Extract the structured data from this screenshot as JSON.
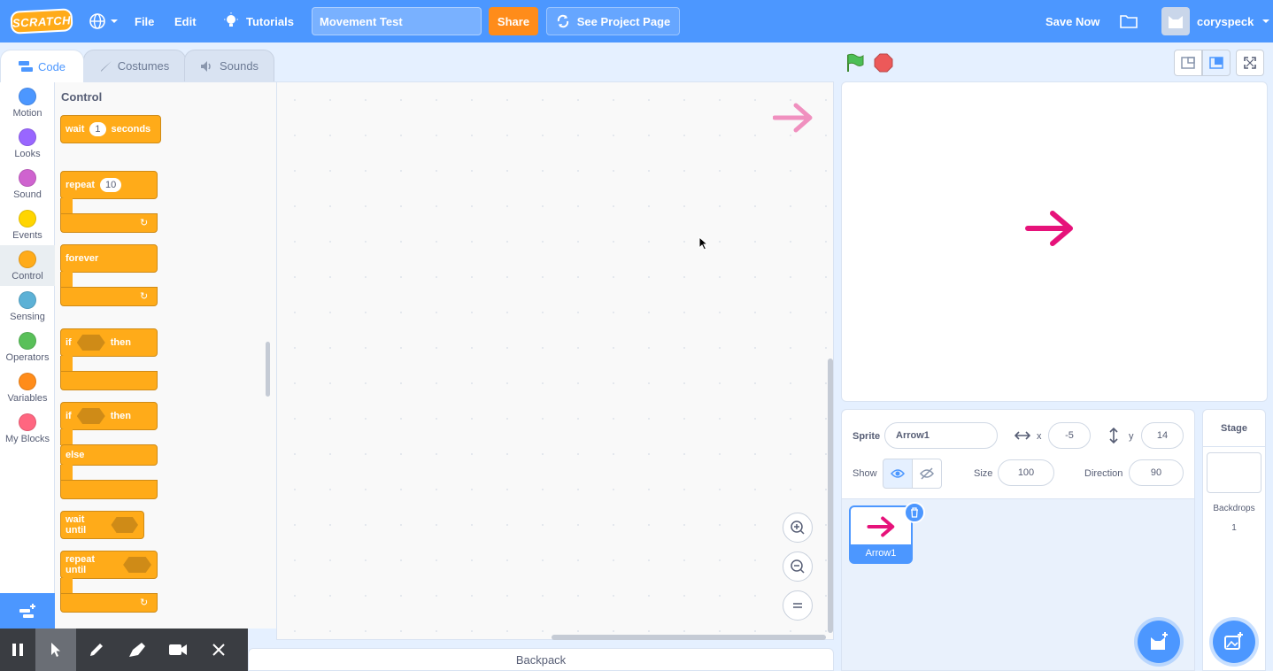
{
  "menubar": {
    "logo_text": "SCRATCH",
    "file_label": "File",
    "edit_label": "Edit",
    "tutorials_label": "Tutorials",
    "project_title": "Movement Test",
    "share_label": "Share",
    "see_project_label": "See Project Page",
    "save_now_label": "Save Now",
    "username": "coryspeck",
    "accent_color": "#4c97ff"
  },
  "tabs": {
    "code": "Code",
    "costumes": "Costumes",
    "sounds": "Sounds"
  },
  "categories": [
    {
      "label": "Motion",
      "color": "#4c97ff"
    },
    {
      "label": "Looks",
      "color": "#9966ff"
    },
    {
      "label": "Sound",
      "color": "#cf63cf"
    },
    {
      "label": "Events",
      "color": "#ffd500"
    },
    {
      "label": "Control",
      "color": "#ffab19"
    },
    {
      "label": "Sensing",
      "color": "#5cb1d6"
    },
    {
      "label": "Operators",
      "color": "#59c059"
    },
    {
      "label": "Variables",
      "color": "#ff8c1a"
    },
    {
      "label": "My Blocks",
      "color": "#ff6680"
    }
  ],
  "palette": {
    "title": "Control",
    "blocks": {
      "wait": "wait",
      "wait_value": "1",
      "wait_seconds": "seconds",
      "repeat": "repeat",
      "repeat_value": "10",
      "forever": "forever",
      "if": "if",
      "then": "then",
      "if2": "if",
      "then2": "then",
      "else": "else",
      "wait_until": "wait until",
      "repeat_until": "repeat until"
    }
  },
  "backpack_label": "Backpack",
  "sprite_info": {
    "sprite_label": "Sprite",
    "sprite_name": "Arrow1",
    "x_label": "x",
    "x_value": "-5",
    "y_label": "y",
    "y_value": "14",
    "show_label": "Show",
    "size_label": "Size",
    "size_value": "100",
    "direction_label": "Direction",
    "direction_value": "90"
  },
  "sprite_list": [
    {
      "name": "Arrow1"
    }
  ],
  "stage_pane": {
    "title": "Stage",
    "backdrops_label": "Backdrops",
    "backdrops_count": "1"
  },
  "icons": {
    "sprite_color": "#e6127a",
    "ghost_sprite_color": "#f07cb4"
  }
}
